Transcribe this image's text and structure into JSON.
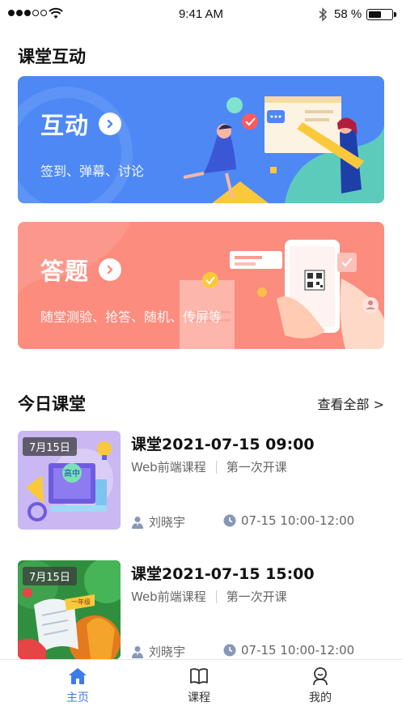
{
  "status_bar": {
    "time": "9:41 AM",
    "battery": "58 %",
    "battery_level": 0.58
  },
  "sections": {
    "interact_title": "课堂互动",
    "today_title": "今日课堂",
    "see_all": "查看全部 >"
  },
  "cards": [
    {
      "title": "互动",
      "desc": "签到、弹幕、讨论",
      "color": "#4d88f5"
    },
    {
      "title": "答题",
      "desc": "随堂测验、抢答、随机、传屏等",
      "color": "#fb8c7e"
    }
  ],
  "courses": [
    {
      "date_tag": "7月15日",
      "title": "课堂2021-07-15 09:00",
      "subject": "Web前端课程",
      "session": "第一次开课",
      "teacher": "刘晓宇",
      "time": "07-15 10:00-12:00",
      "thumb_badge": "高中"
    },
    {
      "date_tag": "7月15日",
      "title": "课堂2021-07-15 15:00",
      "subject": "Web前端课程",
      "session": "第一次开课",
      "teacher": "刘晓宇",
      "time": "07-15 10:00-12:00",
      "thumb_badge": "一年级"
    }
  ],
  "tabs": [
    {
      "label": "主页",
      "icon": "home-icon",
      "active": true
    },
    {
      "label": "课程",
      "icon": "book-icon",
      "active": false
    },
    {
      "label": "我的",
      "icon": "user-icon",
      "active": false
    }
  ],
  "colors": {
    "accent": "#3e7bea",
    "interact_card": "#4d88f5",
    "quiz_card": "#fb8c7e"
  }
}
